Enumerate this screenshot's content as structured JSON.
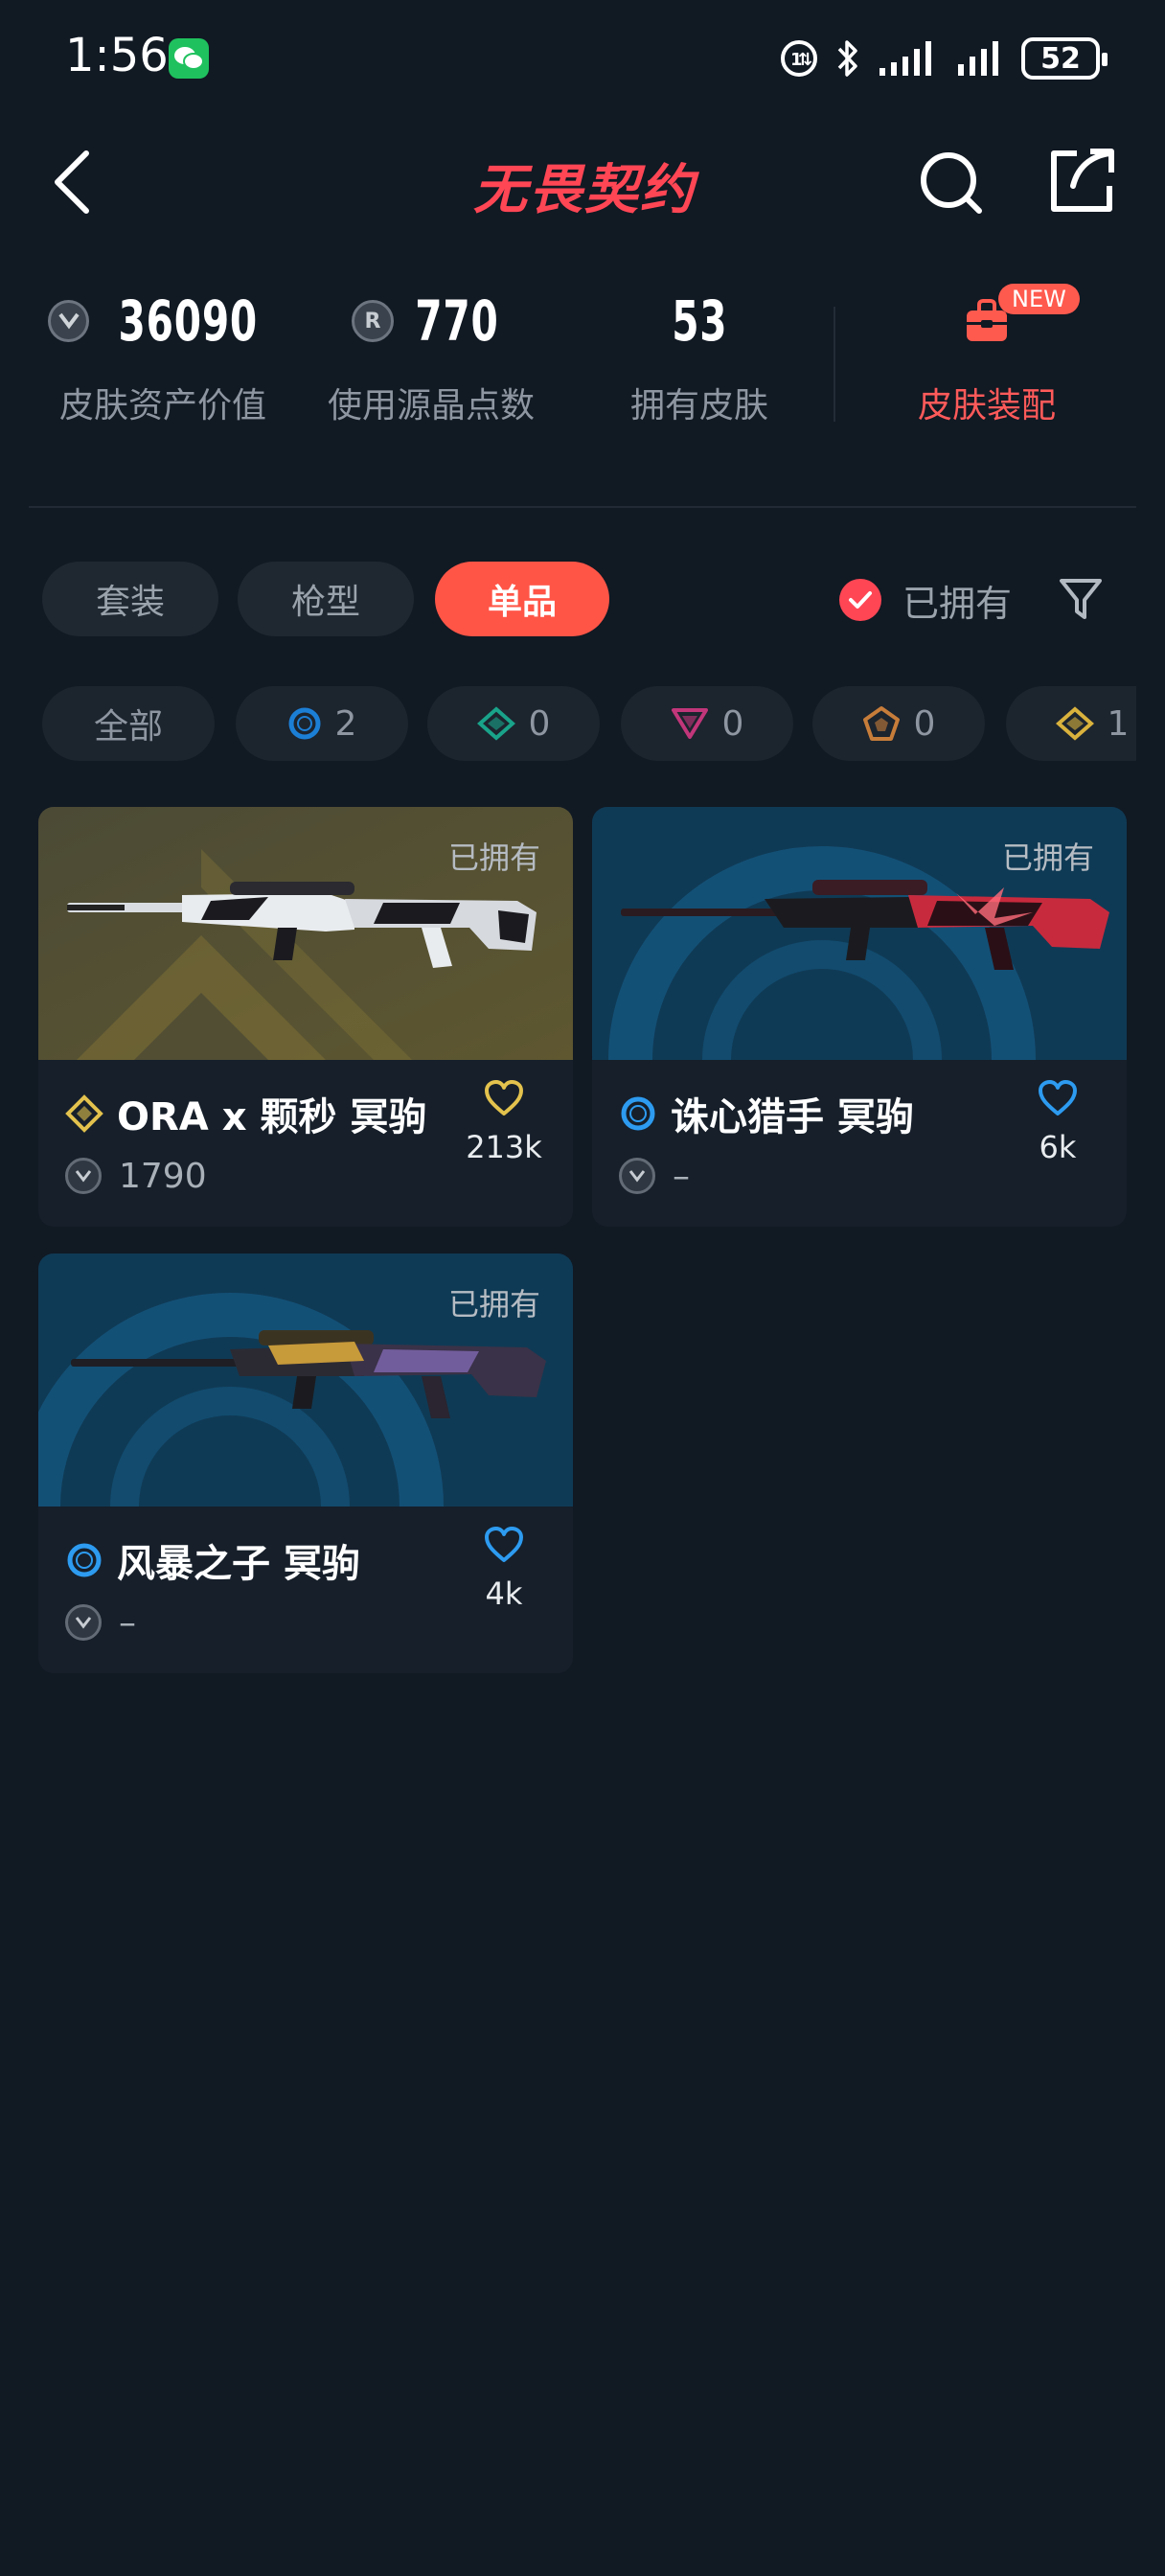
{
  "status_bar": {
    "time": "1:56",
    "battery": "52"
  },
  "header": {
    "logo_text": "无畏契约"
  },
  "stats": [
    {
      "value": "36090",
      "label": "皮肤资产价值",
      "icon": "vp-coin-icon"
    },
    {
      "value": "770",
      "label": "使用源晶点数",
      "icon": "radianite-coin-icon"
    },
    {
      "value": "53",
      "label": "拥有皮肤",
      "icon": ""
    }
  ],
  "outfit": {
    "label": "皮肤装配",
    "badge": "NEW",
    "icon": "bag-icon"
  },
  "tabs": [
    {
      "label": "套装",
      "active": false
    },
    {
      "label": "枪型",
      "active": false
    },
    {
      "label": "单品",
      "active": true
    }
  ],
  "owned_toggle": {
    "label": "已拥有",
    "checked": true
  },
  "tier_chips": [
    {
      "label": "全部",
      "count": "",
      "icon": ""
    },
    {
      "label": "",
      "count": "2",
      "icon": "select-tier-icon",
      "color": "#1c7fd6"
    },
    {
      "label": "",
      "count": "0",
      "icon": "deluxe-tier-icon",
      "color": "#19a38a"
    },
    {
      "label": "",
      "count": "0",
      "icon": "premium-tier-icon",
      "color": "#c2367a"
    },
    {
      "label": "",
      "count": "0",
      "icon": "exclusive-tier-icon",
      "color": "#c77d3a"
    },
    {
      "label": "",
      "count": "1",
      "icon": "ultra-tier-icon",
      "color": "#d9b23d"
    }
  ],
  "cards": [
    {
      "name": "ORA x 颗秒 冥驹",
      "owned": "已拥有",
      "price": "1790",
      "likes": "213k",
      "tier_icon": "ultra-tier-icon",
      "tier_color": "#e3c24d",
      "heart_color": "#e3c24d"
    },
    {
      "name": "诛心猎手 冥驹",
      "owned": "已拥有",
      "price": "–",
      "likes": "6k",
      "tier_icon": "select-tier-icon",
      "tier_color": "#2d9bf0",
      "heart_color": "#2d9bf0"
    },
    {
      "name": "风暴之子 冥驹",
      "owned": "已拥有",
      "price": "–",
      "likes": "4k",
      "tier_icon": "select-tier-icon",
      "tier_color": "#2d9bf0",
      "heart_color": "#2d9bf0"
    }
  ]
}
